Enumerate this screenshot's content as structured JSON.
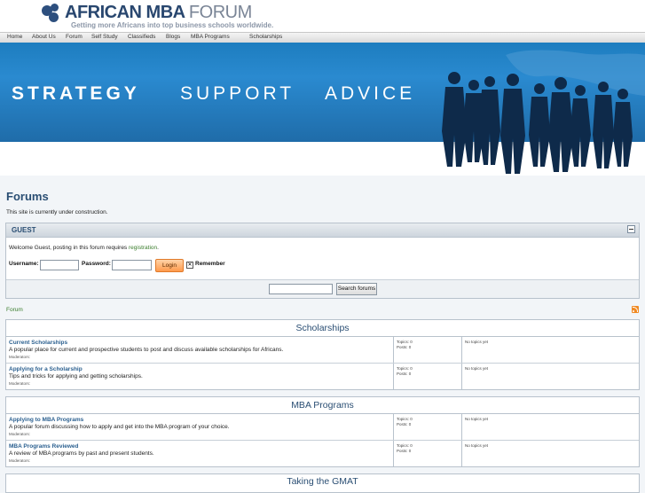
{
  "header": {
    "brand_main": "AFRICAN MBA",
    "brand_thin": "FORUM",
    "tagline": "Getting more Africans into top business schools worldwide."
  },
  "nav": {
    "items": [
      "Home",
      "About Us",
      "Forum",
      "Self Study",
      "Classifieds",
      "Blogs",
      "MBA Programs",
      "Scholarships"
    ]
  },
  "banner": {
    "words": [
      "STRATEGY",
      "SUPPORT",
      "ADVICE"
    ]
  },
  "page": {
    "title": "Forums",
    "notice": "This site is currently under construction."
  },
  "guest": {
    "title": "GUEST",
    "welcome_text": "Welcome Guest, posting in this forum requires ",
    "registration_link": "registration",
    "period": ".",
    "username_label": "Username:",
    "password_label": "Password:",
    "login_label": "Login",
    "remember_label": "Remember",
    "search_button": "Search forums"
  },
  "breadcrumb": "Forum",
  "categories": [
    {
      "title": "Scholarships",
      "forums": [
        {
          "name": "Current Scholarships",
          "desc": "A popular place for current and prospective students to post and discuss available scholarships for Africans.",
          "moderators": "Moderators:",
          "topics": "Topics: 0",
          "posts": "Posts: 0",
          "last": "No topics yet"
        },
        {
          "name": "Applying for a Scholarship",
          "desc": "Tips and tricks for applying and getting scholarships.",
          "moderators": "Moderators:",
          "topics": "Topics: 0",
          "posts": "Posts: 0",
          "last": "No topics yet"
        }
      ]
    },
    {
      "title": "MBA Programs",
      "forums": [
        {
          "name": "Applying to MBA Programs",
          "desc": "A popular forum discussing how to apply and get into the MBA program of your choice.",
          "moderators": "Moderators:",
          "topics": "Topics: 0",
          "posts": "Posts: 0",
          "last": "No topics yet"
        },
        {
          "name": "MBA Programs Reviewed",
          "desc": "A review of MBA programs by past and present students.",
          "moderators": "Moderators:",
          "topics": "Topics: 0",
          "posts": "Posts: 0",
          "last": "No topics yet"
        }
      ]
    },
    {
      "title": "Taking the GMAT",
      "forums": []
    }
  ]
}
